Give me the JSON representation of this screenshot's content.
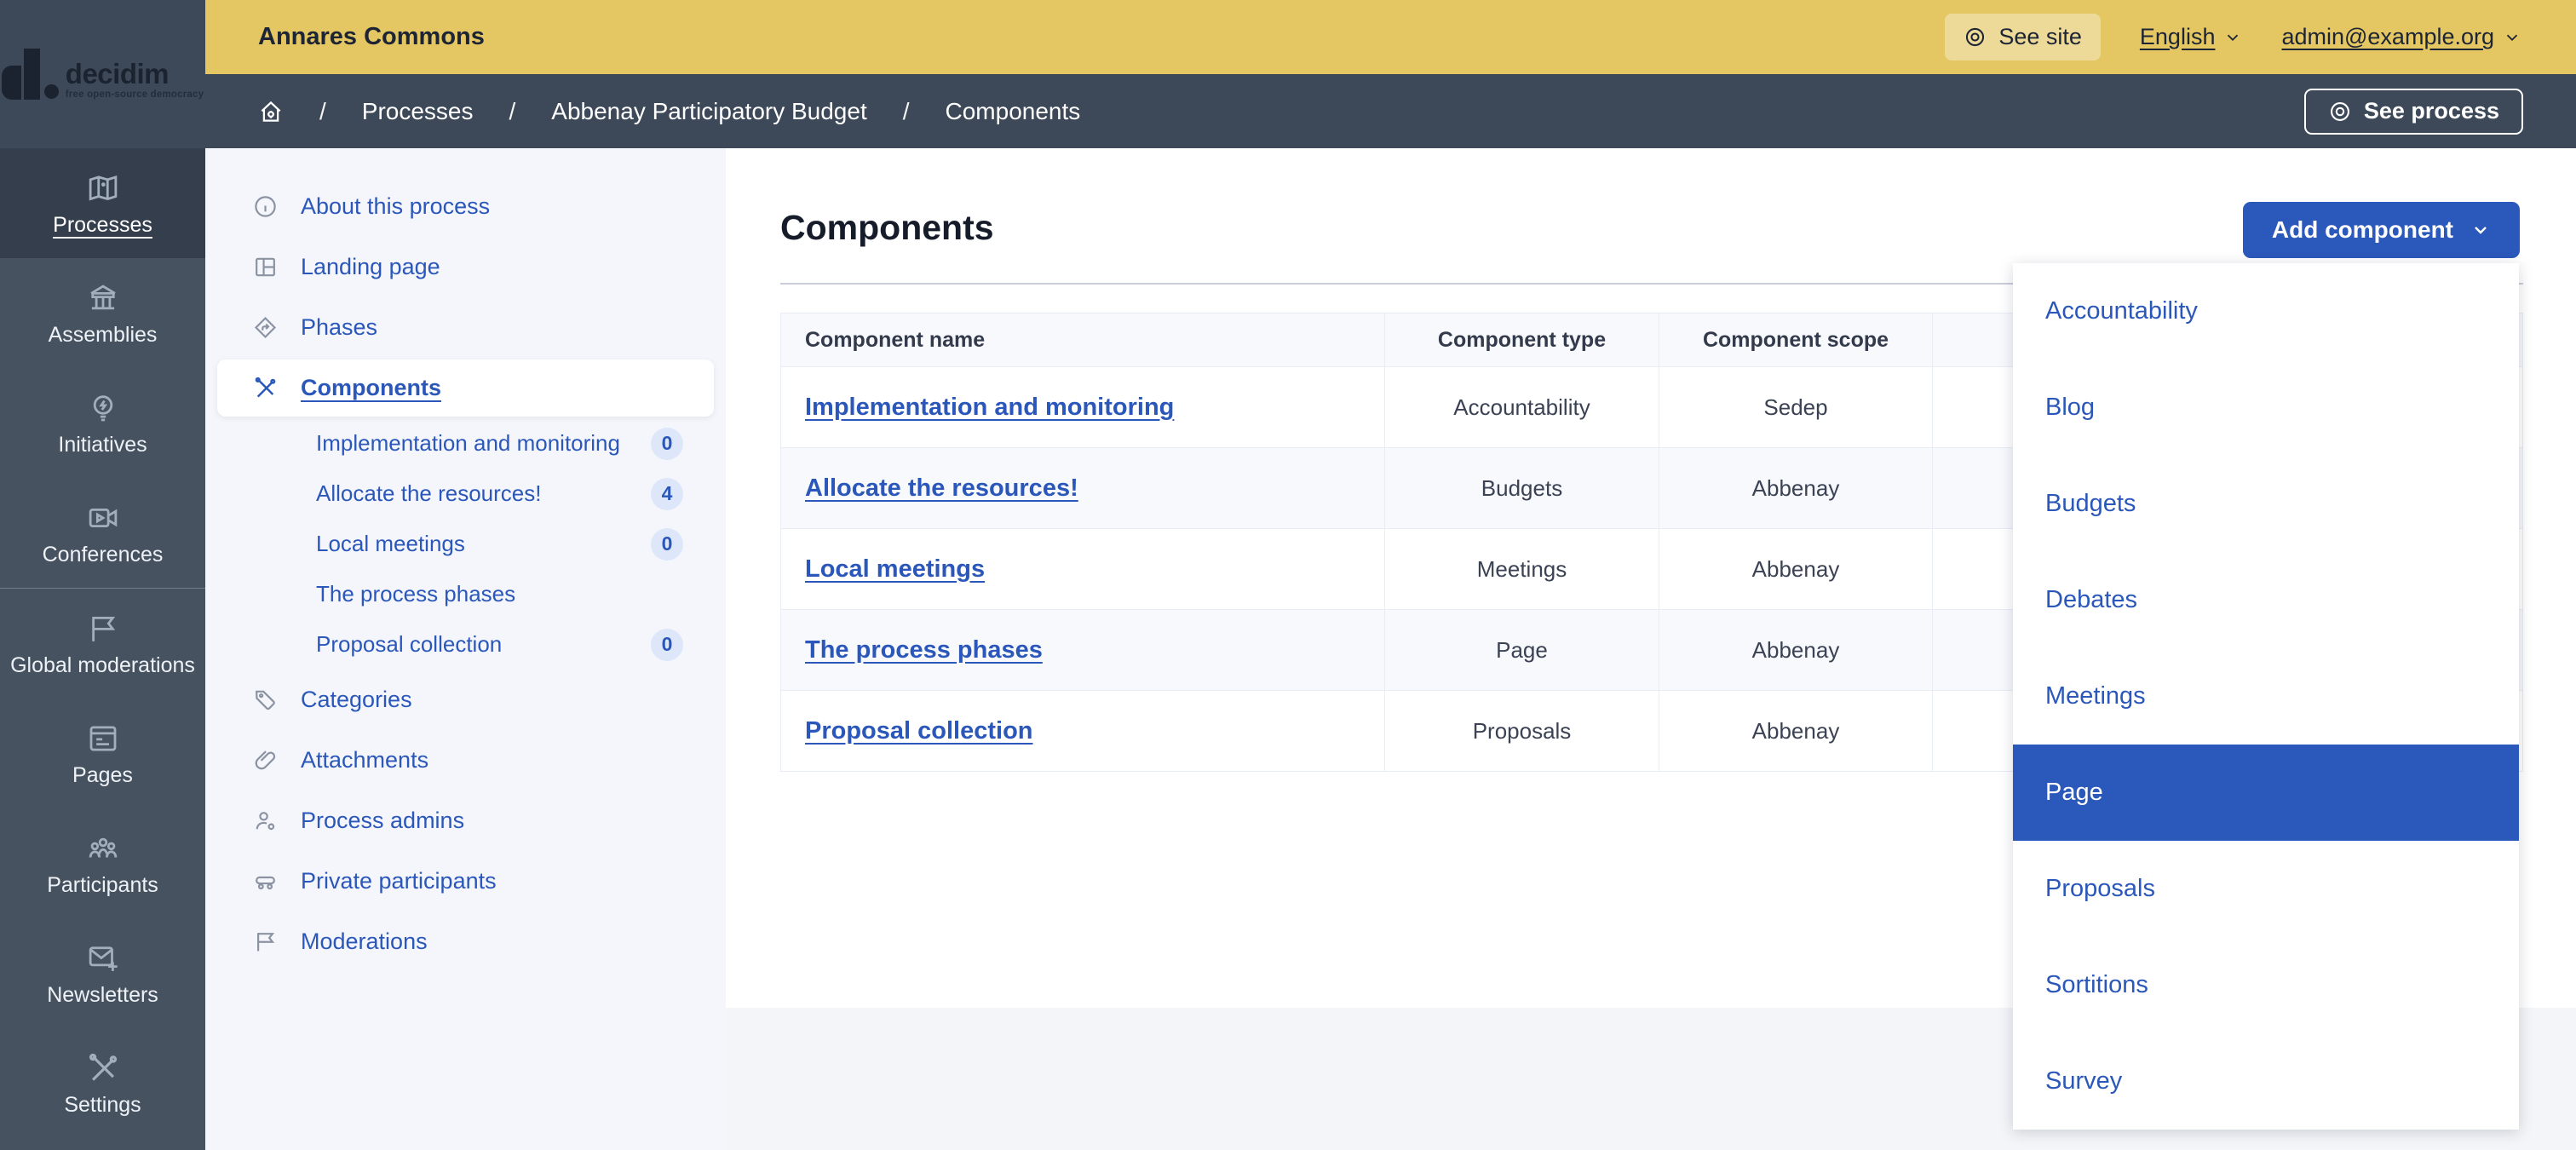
{
  "topbar": {
    "org_name": "Annares Commons",
    "see_site_label": "See site",
    "language_label": "English",
    "user_email": "admin@example.org"
  },
  "logo": {
    "wordmark": "decidim",
    "tagline": "free open-source democracy"
  },
  "breadcrumb": {
    "separator": "/",
    "items": [
      "Processes",
      "Abbenay Participatory Budget",
      "Components"
    ],
    "see_process_label": "See process"
  },
  "sidebar": {
    "items": [
      {
        "label": "Processes",
        "icon": "map-icon",
        "active": true
      },
      {
        "label": "Assemblies",
        "icon": "bank-icon"
      },
      {
        "label": "Initiatives",
        "icon": "lightbulb-icon"
      },
      {
        "label": "Conferences",
        "icon": "video-icon"
      },
      {
        "label": "Global moderations",
        "icon": "flag-icon"
      },
      {
        "label": "Pages",
        "icon": "page-icon"
      },
      {
        "label": "Participants",
        "icon": "group-icon"
      },
      {
        "label": "Newsletters",
        "icon": "mail-add-icon"
      },
      {
        "label": "Settings",
        "icon": "tools-icon"
      }
    ]
  },
  "subnav": {
    "items": [
      {
        "label": "About this process",
        "icon": "info-icon"
      },
      {
        "label": "Landing page",
        "icon": "layout-icon"
      },
      {
        "label": "Phases",
        "icon": "phases-icon"
      },
      {
        "label": "Components",
        "icon": "tools-icon",
        "active": true,
        "children": [
          {
            "label": "Implementation and monitoring",
            "badge": "0"
          },
          {
            "label": "Allocate the resources!",
            "badge": "4"
          },
          {
            "label": "Local meetings",
            "badge": "0"
          },
          {
            "label": "The process phases"
          },
          {
            "label": "Proposal collection",
            "badge": "0"
          }
        ]
      },
      {
        "label": "Categories",
        "icon": "tag-icon"
      },
      {
        "label": "Attachments",
        "icon": "paperclip-icon"
      },
      {
        "label": "Process admins",
        "icon": "user-gear-icon"
      },
      {
        "label": "Private participants",
        "icon": "private-group-icon"
      },
      {
        "label": "Moderations",
        "icon": "flag-icon"
      }
    ]
  },
  "main": {
    "title": "Components",
    "add_component_label": "Add component",
    "table": {
      "columns": [
        "Component name",
        "Component type",
        "Component scope",
        ""
      ],
      "rows": [
        {
          "name": "Implementation and monitoring",
          "type": "Accountability",
          "scope": "Sedep"
        },
        {
          "name": "Allocate the resources!",
          "type": "Budgets",
          "scope": "Abbenay"
        },
        {
          "name": "Local meetings",
          "type": "Meetings",
          "scope": "Abbenay"
        },
        {
          "name": "The process phases",
          "type": "Page",
          "scope": "Abbenay"
        },
        {
          "name": "Proposal collection",
          "type": "Proposals",
          "scope": "Abbenay"
        }
      ]
    }
  },
  "add_menu": {
    "selected": "Page",
    "items": [
      "Accountability",
      "Blog",
      "Budgets",
      "Debates",
      "Meetings",
      "Page",
      "Proposals",
      "Sortitions",
      "Survey"
    ]
  },
  "colors": {
    "topbar_yellow": "#e4c763",
    "navy_header": "#3d4958",
    "sidebar_navy": "#46525f",
    "accent_blue": "#2b58bb",
    "link_blue": "#2a57b9",
    "badge_bg": "#dde7f9"
  }
}
